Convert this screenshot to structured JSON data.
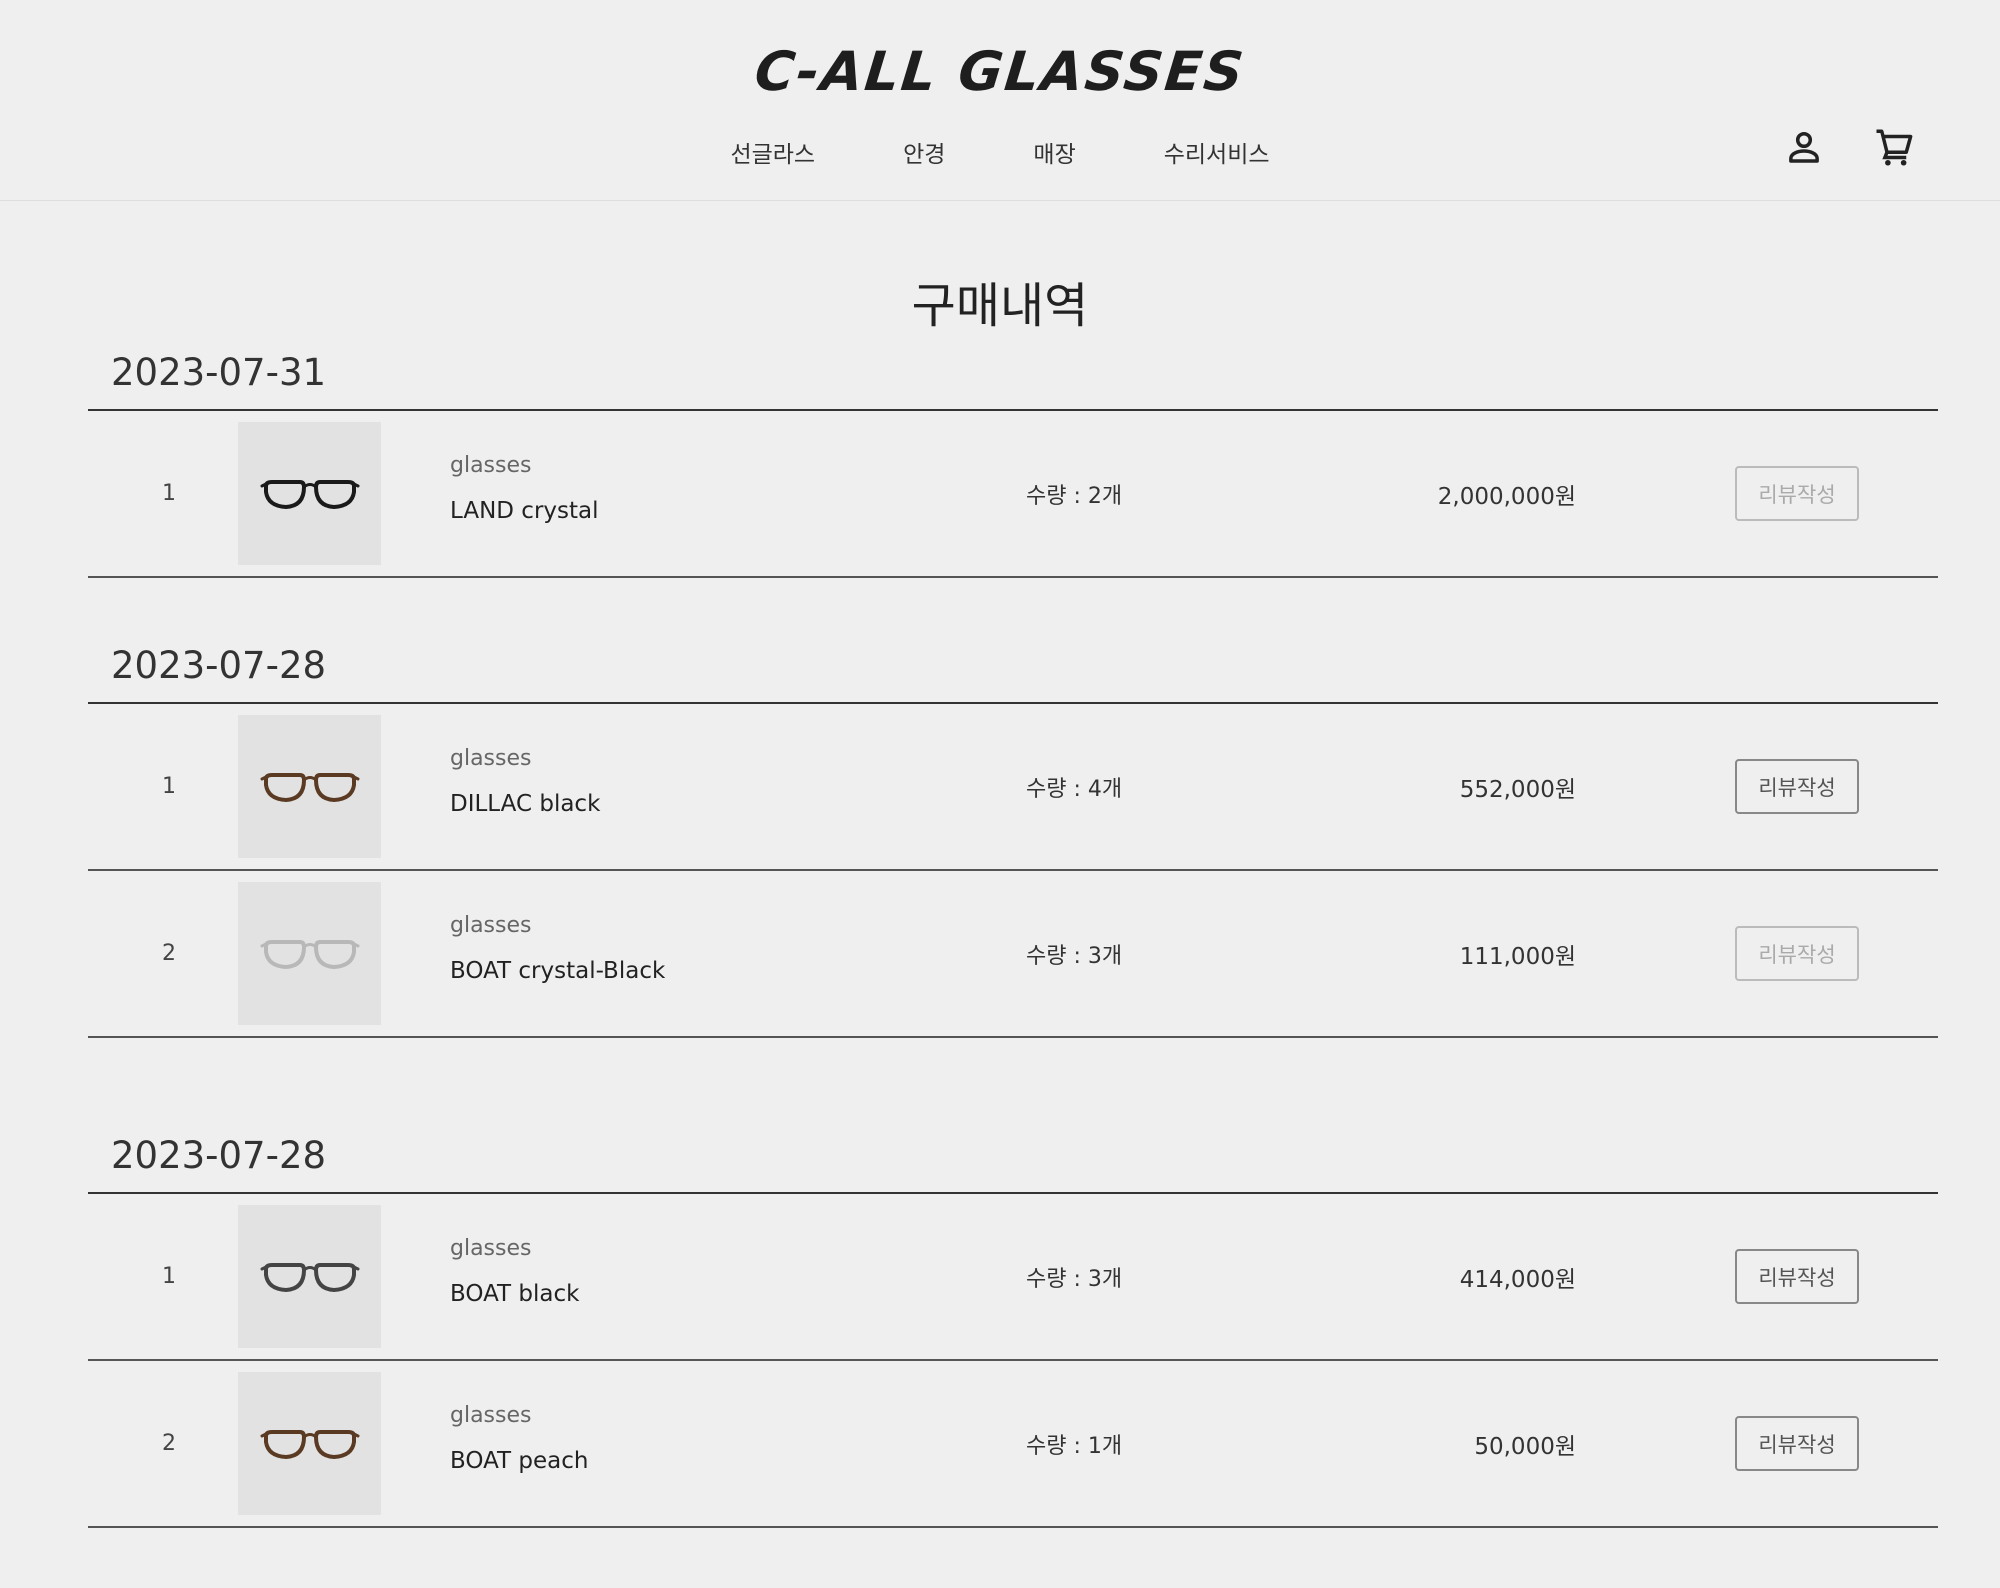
{
  "header": {
    "logo": "C-ALL GLASSES",
    "nav": [
      "선글라스",
      "안경",
      "매장",
      "수리서비스"
    ],
    "icons": [
      "user-icon",
      "cart-icon"
    ]
  },
  "page_title": "구매내역",
  "orders": [
    {
      "date": "2023-07-31",
      "items": [
        {
          "num": "1",
          "category": "glasses",
          "name": "LAND crystal",
          "qty": "수량 : 2개",
          "price": "2,000,000원",
          "review_label": "리뷰작성",
          "review_enabled": false,
          "frame_color": "#1a1a1a"
        }
      ]
    },
    {
      "date": "2023-07-28",
      "items": [
        {
          "num": "1",
          "category": "glasses",
          "name": "DILLAC black",
          "qty": "수량 : 4개",
          "price": "552,000원",
          "review_label": "리뷰작성",
          "review_enabled": true,
          "frame_color": "#5a3a22"
        },
        {
          "num": "2",
          "category": "glasses",
          "name": "BOAT crystal-Black",
          "qty": "수량 : 3개",
          "price": "111,000원",
          "review_label": "리뷰작성",
          "review_enabled": false,
          "frame_color": "#b8b8b8"
        }
      ]
    },
    {
      "date": "2023-07-28",
      "items": [
        {
          "num": "1",
          "category": "glasses",
          "name": "BOAT black",
          "qty": "수량 : 3개",
          "price": "414,000원",
          "review_label": "리뷰작성",
          "review_enabled": true,
          "frame_color": "#444444"
        },
        {
          "num": "2",
          "category": "glasses",
          "name": "BOAT peach",
          "qty": "수량 : 1개",
          "price": "50,000원",
          "review_label": "리뷰작성",
          "review_enabled": true,
          "frame_color": "#5a3a22"
        }
      ]
    }
  ]
}
